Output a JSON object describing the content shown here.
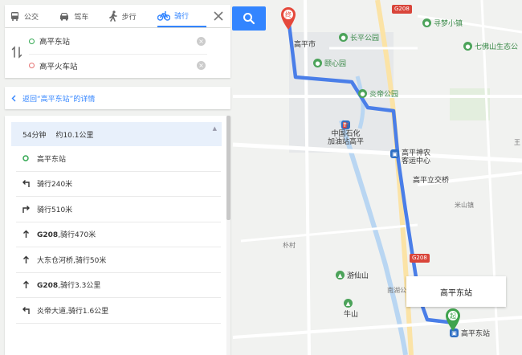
{
  "modes": [
    {
      "label": "公交",
      "icon": "bus-icon",
      "active": false
    },
    {
      "label": "驾车",
      "icon": "car-icon",
      "active": false
    },
    {
      "label": "步行",
      "icon": "walk-icon",
      "active": false
    },
    {
      "label": "骑行",
      "icon": "bike-icon",
      "active": true
    }
  ],
  "route": {
    "origin": "高平东站",
    "destination": "高平火车站"
  },
  "back_link": "返回“高平东站”的详情",
  "summary": {
    "time": "54分钟",
    "distance": "约10.1公里"
  },
  "steps": [
    {
      "icon": "origin-ring-icon",
      "bold": "",
      "text": "高平东站"
    },
    {
      "icon": "turn-left-icon",
      "bold": "",
      "text": "骑行240米"
    },
    {
      "icon": "turn-right-icon",
      "bold": "",
      "text": "骑行510米"
    },
    {
      "icon": "straight-icon",
      "bold": "G208",
      "text": ",骑行470米"
    },
    {
      "icon": "straight-icon",
      "bold": "",
      "text": "大东仓河桥,骑行50米"
    },
    {
      "icon": "straight-icon",
      "bold": "G208",
      "text": ",骑行3.3公里"
    },
    {
      "icon": "turn-left-icon",
      "bold": "",
      "text": "炎帝大道,骑行1.6公里"
    }
  ],
  "map": {
    "pois": [
      {
        "name": "长平公园",
        "color": "green"
      },
      {
        "name": "颐心园",
        "color": "green"
      },
      {
        "name": "炎帝公园",
        "color": "green"
      },
      {
        "name": "寻梦小镇",
        "color": "green"
      },
      {
        "name": "七佛山生态公",
        "color": "green"
      },
      {
        "name": "中国石化\n加油站高平",
        "color": "blue"
      },
      {
        "name": "高平神农\n客运中心",
        "color": "blue"
      },
      {
        "name": "游仙山",
        "color": "green"
      },
      {
        "name": "牛山",
        "color": "green"
      },
      {
        "name": "高平东站",
        "color": "blue"
      }
    ],
    "places": [
      "高平市",
      "高平立交桥",
      "米山镇",
      "朴村",
      "南湖公",
      "王"
    ],
    "road_badges": [
      "G208",
      "G208"
    ],
    "info_box": "高平东站",
    "end_marker": "终",
    "start_marker": "起",
    "accent": "#3385ff",
    "route_color": "#4a7ee8"
  }
}
